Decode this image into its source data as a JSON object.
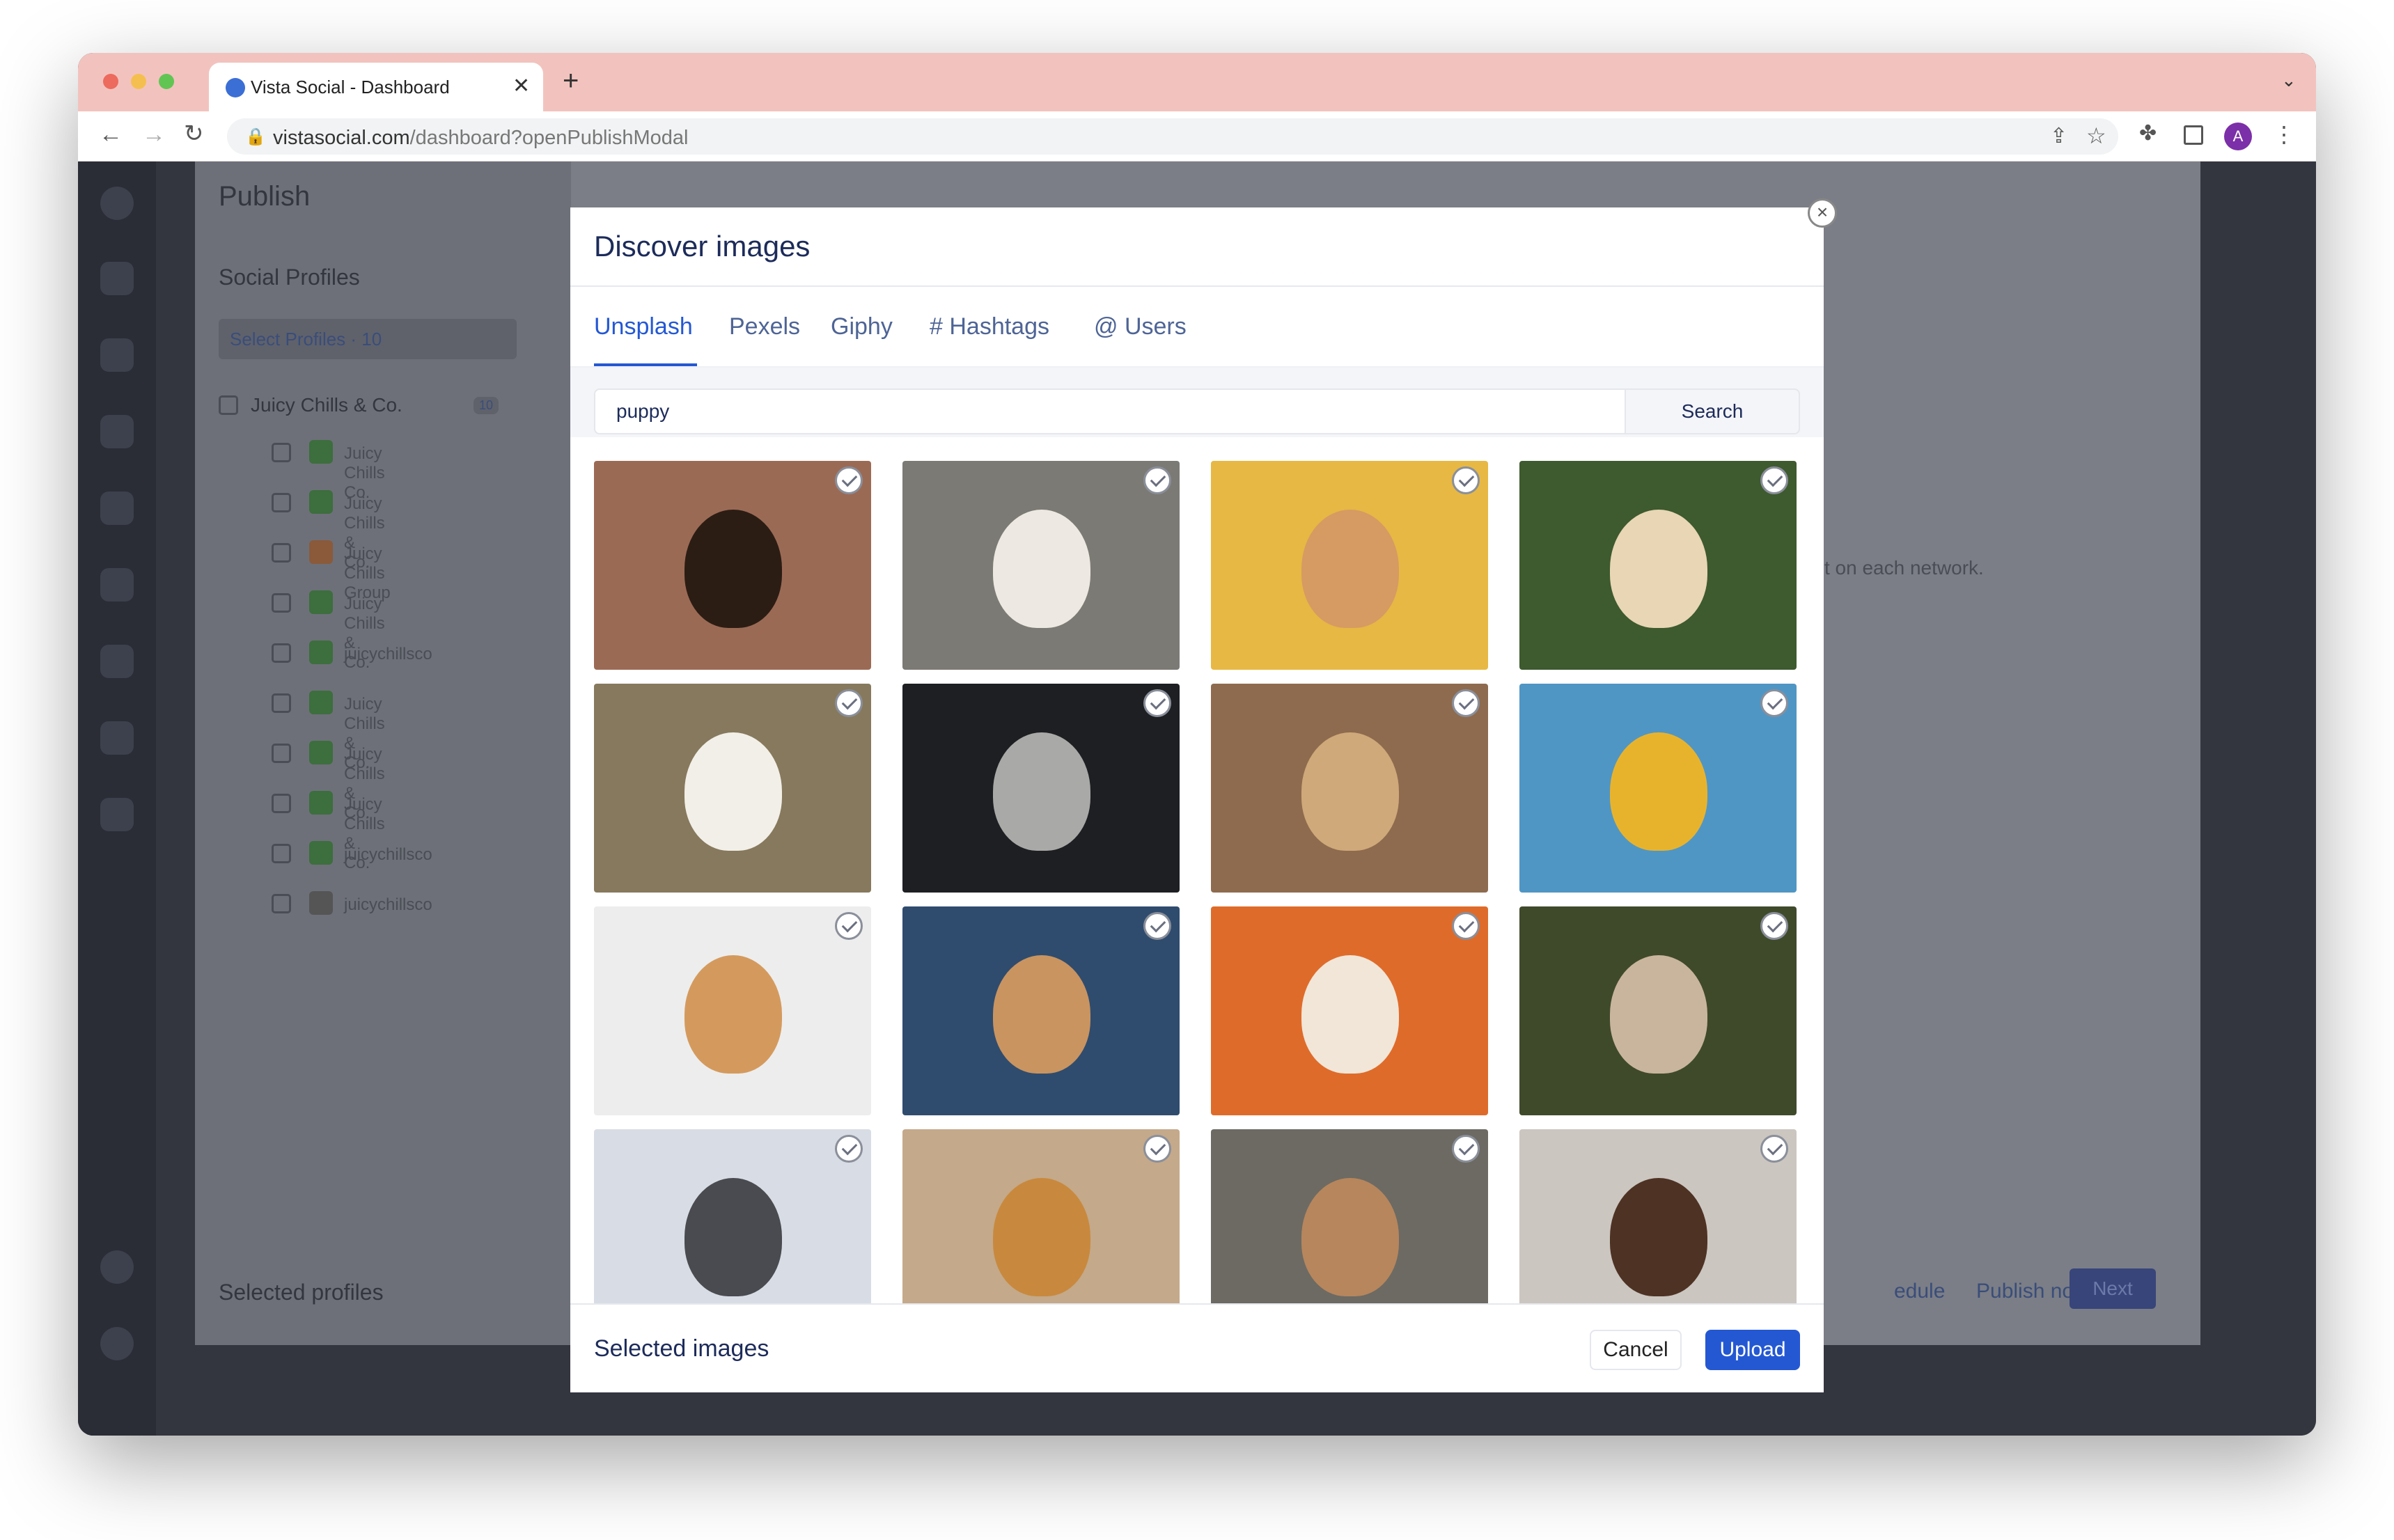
{
  "browser": {
    "tab_title": "Vista Social - Dashboard",
    "url_host": "vistasocial.com",
    "url_path": "/dashboard?openPublishModal",
    "avatar_initial": "A"
  },
  "publish": {
    "title": "Publish",
    "social_profiles": "Social Profiles",
    "select_profiles": "Select Profiles · 10",
    "group_name": "Juicy Chills & Co.",
    "group_count": "10",
    "profiles": [
      "Juicy Chills Co.",
      "Juicy Chills & Co.",
      "Juicy Chills Group",
      "Juicy Chills & Co.",
      "juicychillsco",
      "Juicy Chills & Co.",
      "Juicy Chills & Co.",
      "Juicy Chills & Co.",
      "juicychillsco",
      "juicychillsco"
    ],
    "selected_profiles": "Selected profiles",
    "publish_now": "Publish now",
    "schedule_partial": "edule",
    "next": "Next",
    "on_each_network": "t on each network."
  },
  "modal": {
    "title": "Discover images",
    "tabs": [
      "Unsplash",
      "Pexels",
      "Giphy",
      "# Hashtags",
      "@ Users"
    ],
    "search_value": "puppy",
    "search_button": "Search",
    "selected_label": "Selected images",
    "cancel": "Cancel",
    "upload": "Upload"
  },
  "images": [
    {
      "name": "yorkie-puppy-on-rug",
      "bg": "#9b6a55",
      "fg": "#2b1d14"
    },
    {
      "name": "aussie-puppy-blue-collar",
      "bg": "#7c7a75",
      "fg": "#ede9e2"
    },
    {
      "name": "poodle-puppy-yellow-bg",
      "bg": "#e7b843",
      "fg": "#d69a63"
    },
    {
      "name": "golden-puppy-on-grass",
      "bg": "#3e5a2f",
      "fg": "#e8d6b4"
    },
    {
      "name": "jack-russell-puppy-flowers",
      "bg": "#87795d",
      "fg": "#f2efe8"
    },
    {
      "name": "puppy-running-on-street",
      "bg": "#1d1f22",
      "fg": "#a9a9a7"
    },
    {
      "name": "golden-retriever-puppy",
      "bg": "#8e6b4e",
      "fg": "#cfa97a"
    },
    {
      "name": "french-bulldog-yellow-hoodie",
      "bg": "#4f96c5",
      "fg": "#e8b32c"
    },
    {
      "name": "corgi-lying-white-bg",
      "bg": "#ededed",
      "fg": "#d49a5d"
    },
    {
      "name": "poodle-puppy-walking",
      "bg": "#2f4c6e",
      "fg": "#c99460"
    },
    {
      "name": "corgi-puppy-orange-bg",
      "bg": "#df6b2a",
      "fg": "#f1e6d8"
    },
    {
      "name": "kitten-and-dog-grass",
      "bg": "#3f4a2b",
      "fg": "#c9b59d"
    },
    {
      "name": "aussie-puppy-tongue-out",
      "bg": "#d8dde5",
      "fg": "#4a4b50"
    },
    {
      "name": "golden-puppy-licking",
      "bg": "#c4a98a",
      "fg": "#c8893e"
    },
    {
      "name": "puppy-on-patio",
      "bg": "#6c6a63",
      "fg": "#b7865d"
    },
    {
      "name": "shih-tzu-puppy-blanket",
      "bg": "#cbc6c0",
      "fg": "#4e3224"
    }
  ]
}
